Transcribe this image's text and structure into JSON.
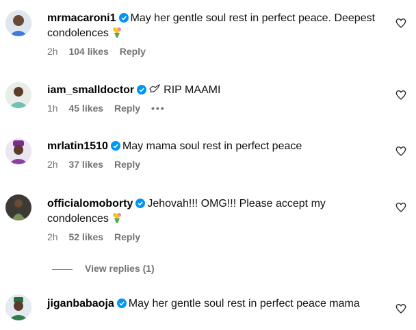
{
  "comments": [
    {
      "username": "mrmacaroni1",
      "verified": true,
      "text": "May her gentle soul rest in perfect peace. Deepest condolences",
      "emoji": "bouquet-icon",
      "time": "2h",
      "likes": "104 likes",
      "reply": "Reply"
    },
    {
      "username": "iam_smalldoctor",
      "verified": true,
      "text": "RIP MAAMI",
      "emoji": "dove-icon",
      "time": "1h",
      "likes": "45 likes",
      "reply": "Reply",
      "more": "•••"
    },
    {
      "username": "mrlatin1510",
      "verified": true,
      "text": "May mama soul rest in perfect peace",
      "time": "2h",
      "likes": "37 likes",
      "reply": "Reply"
    },
    {
      "username": "officialomoborty",
      "verified": true,
      "text": "Jehovah!!! OMG!!! Please accept my condolences",
      "emoji": "bouquet-icon",
      "time": "2h",
      "likes": "52 likes",
      "reply": "Reply"
    },
    {
      "username": "jiganbabaoja",
      "verified": true,
      "text": "May her gentle soul rest in perfect peace mama"
    }
  ],
  "view_replies": "View replies (1)",
  "colors": {
    "verified": "#0095f6",
    "meta": "#737373",
    "text": "#000000"
  }
}
